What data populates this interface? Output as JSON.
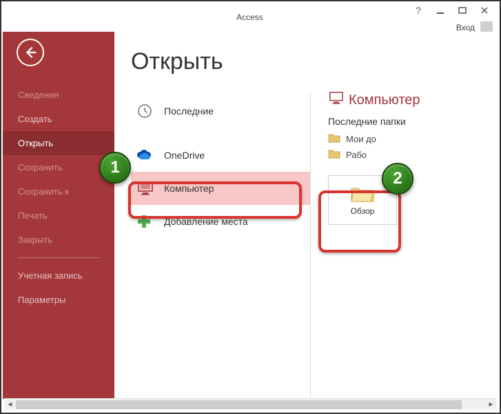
{
  "app_title": "Access",
  "help_symbol": "?",
  "login_label": "Вход",
  "sidebar": {
    "items": [
      {
        "label": "Сведения",
        "dim": true
      },
      {
        "label": "Создать",
        "dim": false
      },
      {
        "label": "Открыть",
        "dim": false,
        "active": true
      },
      {
        "label": "Сохранить",
        "dim": true
      },
      {
        "label": "Сохранить к",
        "dim": true
      },
      {
        "label": "Печать",
        "dim": true
      },
      {
        "label": "Закрыть",
        "dim": true
      }
    ],
    "account_label": "Учетная запись",
    "options_label": "Параметры"
  },
  "page_title": "Открыть",
  "locations": [
    {
      "label": "Последние",
      "icon": "clock"
    },
    {
      "label": "OneDrive",
      "icon": "onedrive"
    },
    {
      "label": "Компьютер",
      "icon": "computer",
      "selected": true
    },
    {
      "label": "Добавление места",
      "icon": "add"
    }
  ],
  "right_panel": {
    "header": "Компьютер",
    "recent_label": "Последние папки",
    "folders": [
      {
        "label": "Мои до"
      },
      {
        "label": "Рабо"
      }
    ],
    "browse_label": "Обзор"
  },
  "callouts": {
    "one": "1",
    "two": "2"
  }
}
